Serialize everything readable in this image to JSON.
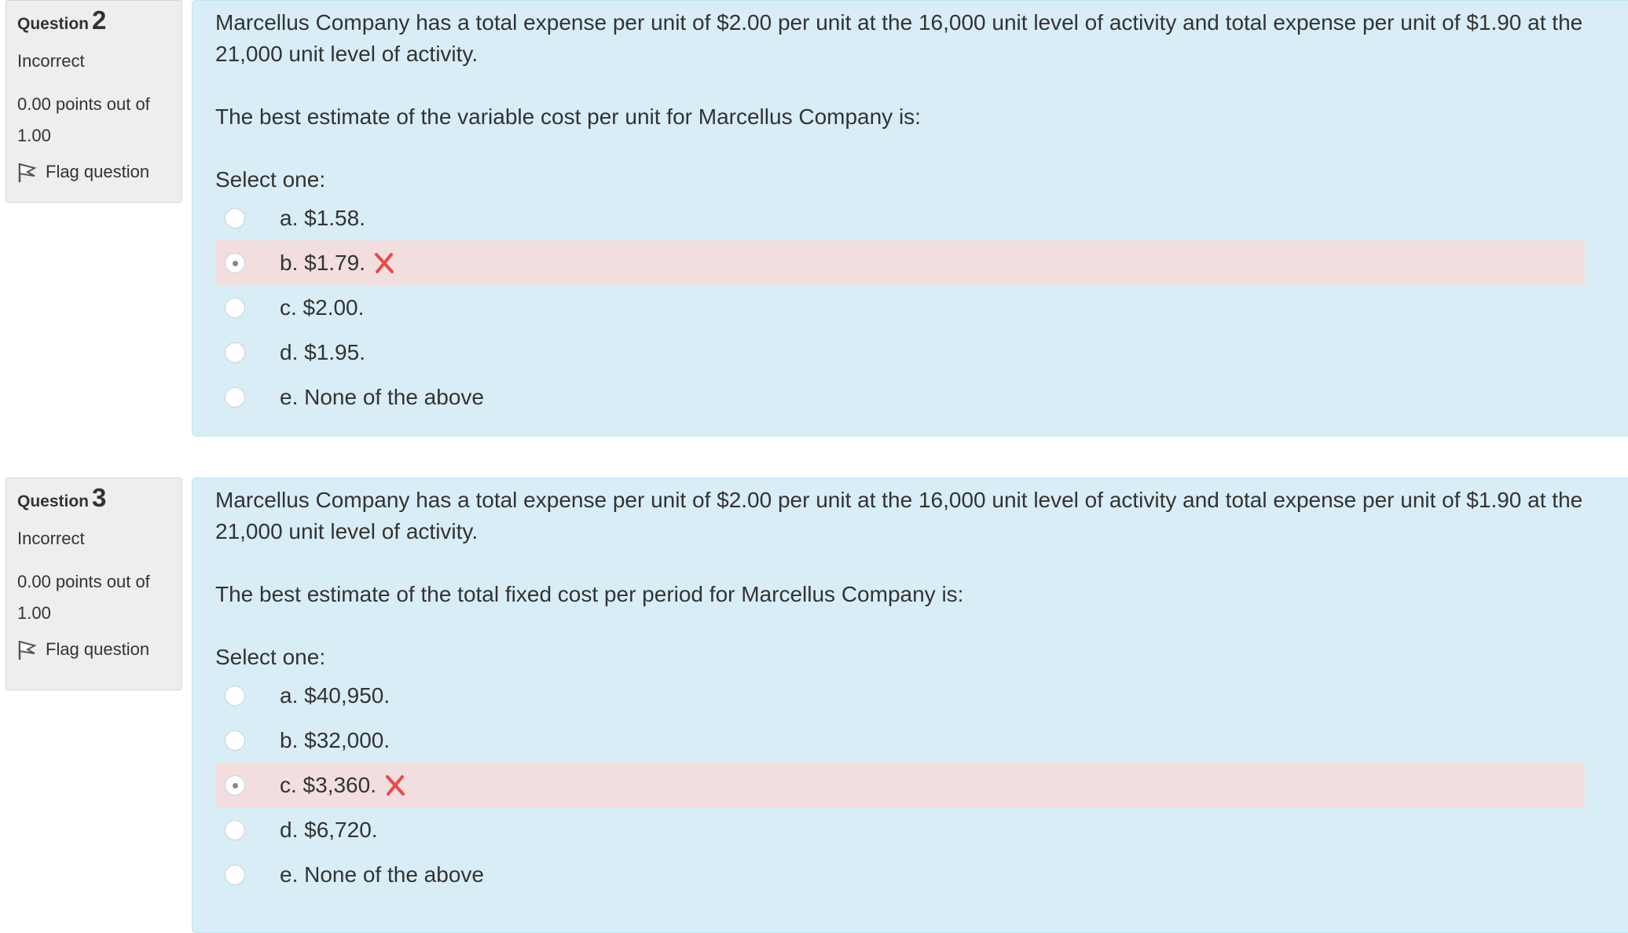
{
  "colors": {
    "info_bg": "#eeeeee",
    "content_bg": "#d9edf6",
    "incorrect_row_bg": "#f2dede",
    "incorrect_mark": "#e84a4a"
  },
  "questions": [
    {
      "label": "Question",
      "number": "2",
      "state": "Incorrect",
      "grade": "0.00 points out of 1.00",
      "flag_label": "Flag question",
      "flag_icon": "flag-icon",
      "text": "Marcellus Company has a total expense per unit of $2.00 per unit at the 16,000 unit level of activity and total expense per unit of $1.90 at the 21,000 unit level of activity.",
      "text2": "The best estimate of the variable cost per unit for Marcellus Company is:",
      "prompt": "Select one:",
      "answers": [
        {
          "label": "a. $1.58.",
          "selected": false,
          "incorrect": false
        },
        {
          "label": "b. $1.79.",
          "selected": true,
          "incorrect": true
        },
        {
          "label": "c. $2.00.",
          "selected": false,
          "incorrect": false
        },
        {
          "label": "d. $1.95.",
          "selected": false,
          "incorrect": false
        },
        {
          "label": "e. None of the above",
          "selected": false,
          "incorrect": false
        }
      ]
    },
    {
      "label": "Question",
      "number": "3",
      "state": "Incorrect",
      "grade": "0.00 points out of 1.00",
      "flag_label": "Flag question",
      "flag_icon": "flag-icon",
      "text": "Marcellus Company has a total expense per unit of $2.00 per unit at the 16,000 unit level of activity and total expense per unit of $1.90 at the 21,000 unit level of activity.",
      "text2": "The best estimate of the total fixed cost per period for Marcellus Company is:",
      "prompt": "Select one:",
      "answers": [
        {
          "label": "a. $40,950.",
          "selected": false,
          "incorrect": false
        },
        {
          "label": "b. $32,000.",
          "selected": false,
          "incorrect": false
        },
        {
          "label": "c. $3,360.",
          "selected": true,
          "incorrect": true
        },
        {
          "label": "d. $6,720.",
          "selected": false,
          "incorrect": false
        },
        {
          "label": "e. None of the above",
          "selected": false,
          "incorrect": false
        }
      ]
    }
  ]
}
